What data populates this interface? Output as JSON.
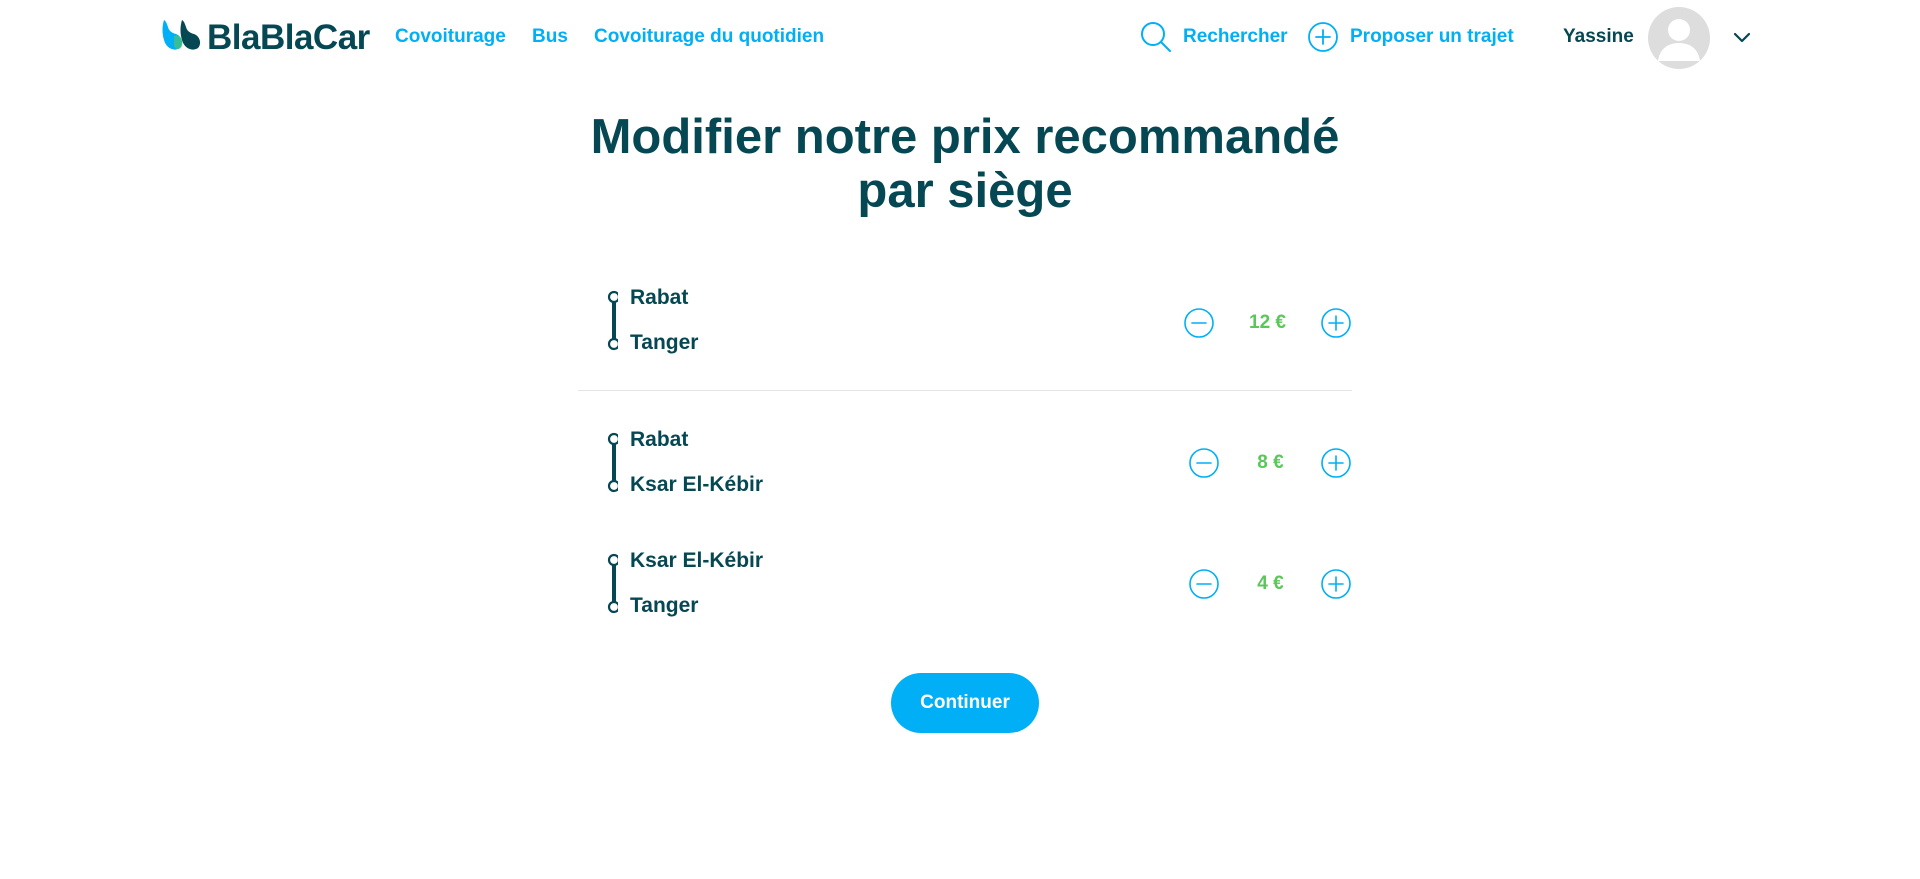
{
  "brand": {
    "name": "BlaBlaCar",
    "primary_color": "#00aff5",
    "text_color": "#054752",
    "price_color": "#5bc65a"
  },
  "nav": {
    "links": [
      "Covoiturage",
      "Bus",
      "Covoiturage du quotidien"
    ],
    "search_label": "Rechercher",
    "offer_label": "Proposer un trajet",
    "user_name": "Yassine",
    "icons": {
      "search": "search-icon",
      "offer": "plus-circle-icon",
      "avatar": "avatar-placeholder",
      "menu": "chevron-down-icon"
    }
  },
  "page": {
    "title_line1": "Modifier notre prix recommandé",
    "title_line2": "par siège"
  },
  "segments": [
    {
      "from": "Rabat",
      "to": "Tanger",
      "price": "12 €"
    },
    {
      "from": "Rabat",
      "to": "Ksar El-Kébir",
      "price": "8 €"
    },
    {
      "from": "Ksar El-Kébir",
      "to": "Tanger",
      "price": "4 €"
    }
  ],
  "actions": {
    "continue_label": "Continuer"
  }
}
